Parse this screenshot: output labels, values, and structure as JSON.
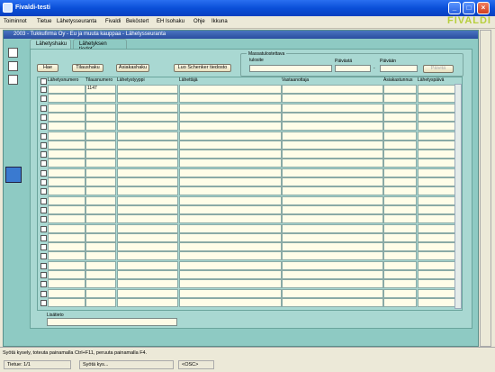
{
  "window": {
    "title": "Fivaldi-testi"
  },
  "menu": [
    "Toiminnot",
    "Tietue",
    "Lähetysseuranta",
    "Fivaldi",
    "Beköstert",
    "EH Isohaku",
    "Ohje",
    "Ikkuna"
  ],
  "logo": "FIVALDI",
  "form": {
    "title": "2003 - Tukkufirma Oy - Eu ja muuta kauppaa - Lähetysseuranta"
  },
  "tabs": [
    {
      "label": "Lähetyshaku",
      "active": true
    },
    {
      "label": "Lähetyksen tiedot",
      "active": false
    }
  ],
  "buttons": {
    "hae": "Hae",
    "tilaushaku": "Tilaushaku",
    "asiakashaku": "Asiakashaku",
    "luo": "Luo Schenker tiedosto",
    "paivita": "Päivitä"
  },
  "mass": {
    "group_label": "Massatulostettava",
    "sub_label": "tulosite",
    "from_label": "Päivästä",
    "to_label": "Päivään"
  },
  "columns": [
    "Lähetysnumero",
    "Tilausnumero",
    "Lähetystyyppi",
    "Lähettäjä",
    "Vastaanottaja",
    "Asiakastunnus",
    "Lähetyspäivä"
  ],
  "first_row": {
    "tilausnumero": "1147"
  },
  "lisatieto_label": "Lisätieto",
  "status": {
    "message": "Syötä kysely, toteuta painamalla Ctrl+F11, peruuta painamalla F4.",
    "record": "Tietue: 1/1",
    "mode": "Syötä kys...",
    "osc": "<OSC>"
  },
  "colors": {
    "titlebar": "#0a4fd8",
    "panel": "#a9d8d2",
    "accent": "#b7cf3c"
  }
}
